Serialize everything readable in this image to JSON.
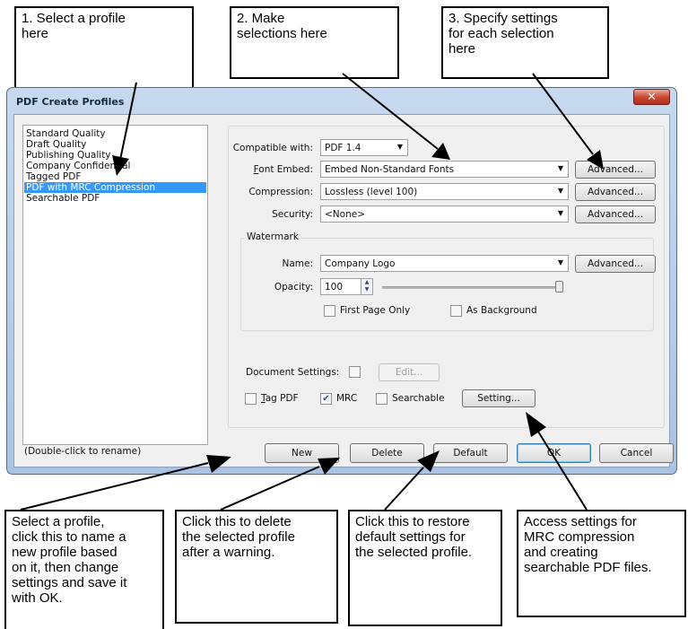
{
  "callouts": {
    "top1": [
      "1. Select a profile",
      "here"
    ],
    "top2": [
      "2. Make",
      "selections here"
    ],
    "top3": [
      "3. Specify settings",
      "for each selection",
      "here"
    ],
    "bottom1": [
      "Select a profile,",
      "click this to name a",
      "new profile based",
      "on it, then change",
      "settings and save it",
      "with OK."
    ],
    "bottom2": [
      "Click this to delete",
      "the selected profile",
      "after a warning."
    ],
    "bottom3": [
      "Click this to restore",
      "default settings for",
      "the selected profile."
    ],
    "bottom4": [
      "Access settings for",
      "MRC compression",
      "and creating",
      "searchable PDF files."
    ]
  },
  "dialog": {
    "title": "PDF Create Profiles",
    "close_glyph": "✕",
    "profiles": [
      "Standard Quality",
      "Draft Quality",
      "Publishing Quality",
      "Company Confidential",
      "Tagged PDF",
      "PDF with MRC Compression",
      "Searchable PDF"
    ],
    "selected_profile": "PDF with MRC Compression",
    "rename_hint": "(Double-click to rename)",
    "compatible_with": {
      "label": "Compatible with:",
      "value": "PDF 1.4"
    },
    "font_embed": {
      "label_key": "F",
      "label_rest": "ont Embed:",
      "value": "Embed Non-Standard Fonts"
    },
    "compression": {
      "label": "Compression:",
      "value": "Lossless (level 100)"
    },
    "security": {
      "label": "Security:",
      "value": "<None>"
    },
    "advanced_label": "Advanced...",
    "watermark": {
      "group_label": "Watermark",
      "name_label": "Name:",
      "name_value": "Company Logo",
      "opacity_label": "Opacity:",
      "opacity_value": "100",
      "first_page_only": "First Page Only",
      "as_background": "As Background"
    },
    "document_settings_label": "Document Settings:",
    "edit_label": "Edit...",
    "tag_pdf": {
      "key": "T",
      "rest": "ag PDF",
      "checked": false
    },
    "mrc": {
      "label": "MRC",
      "checked": true
    },
    "searchable": {
      "label": "Searchable",
      "checked": false
    },
    "setting_label": "Setting...",
    "buttons": {
      "new": "New",
      "delete": "Delete",
      "default": "Default",
      "ok": "OK",
      "cancel": "Cancel"
    },
    "colors": {
      "selection": "#3399ff",
      "close": "#c8432f",
      "title_bar": "#b9cfea"
    }
  }
}
